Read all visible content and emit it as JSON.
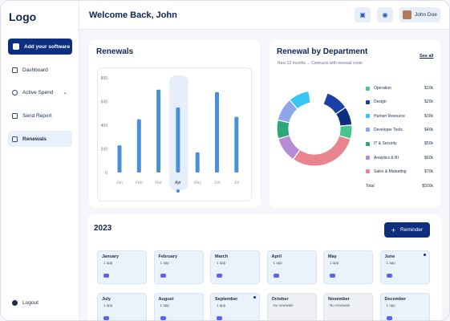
{
  "sidebar": {
    "logo": "Logo",
    "add_button": "Add your software",
    "items": [
      {
        "label": "Dashboard",
        "icon": "grid-icon"
      },
      {
        "label": "Active Spend",
        "icon": "refresh-icon"
      },
      {
        "label": "Send Report",
        "icon": "document-icon"
      },
      {
        "label": "Renewals",
        "icon": "calendar-icon"
      }
    ],
    "logout": "Logout"
  },
  "header": {
    "welcome": "Welcome Back, John",
    "user_name": "John Doe"
  },
  "renewals": {
    "title": "Renewals"
  },
  "chart_data": {
    "type": "bar",
    "categories": [
      "Jan",
      "Feb",
      "Mar",
      "Apr",
      "May",
      "Jun",
      "Jul"
    ],
    "series": [
      {
        "values": [
          230,
          450,
          700,
          550,
          170,
          680,
          470
        ]
      },
      {
        "values": [
          0,
          0,
          0,
          0,
          0,
          0,
          0
        ]
      }
    ],
    "highlight_category": "Apr",
    "yticks": [
      0,
      200,
      400,
      600,
      800
    ],
    "ylim": [
      0,
      800
    ],
    "title": "Renewals"
  },
  "department": {
    "title": "Renewal by Department",
    "subtitle": "Next 12 months ... Contracts with renewal costs",
    "see_all": "See all",
    "total_label": "Total",
    "total_value": "$500k",
    "items": [
      {
        "label": "Operation",
        "value": "$10k",
        "color": "#4cc38a"
      },
      {
        "label": "Design",
        "value": "$20k",
        "color": "#1a3fa6"
      },
      {
        "label": "Human Resource",
        "value": "$30k",
        "color": "#35c6f4"
      },
      {
        "label": "Developer Tools",
        "value": "$40k",
        "color": "#8fa6ea"
      },
      {
        "label": "IT & Security",
        "value": "$50k",
        "color": "#2ea67a"
      },
      {
        "label": "Analytics & BI",
        "value": "$60k",
        "color": "#b48bd6"
      },
      {
        "label": "Sales & Marketing",
        "value": "$70k",
        "color": "#e9848f"
      }
    ],
    "donut_order": [
      {
        "name": "Design",
        "share": 0.1,
        "color": "#1a3fa6"
      },
      {
        "name": "Navy",
        "share": 0.08,
        "color": "#0e2f80"
      },
      {
        "name": "Operation",
        "share": 0.06,
        "color": "#4cc38a"
      },
      {
        "name": "Sales & Marketing",
        "share": 0.3,
        "color": "#e9848f"
      },
      {
        "name": "Analytics & BI",
        "share": 0.11,
        "color": "#b48bd6"
      },
      {
        "name": "IT & Security",
        "share": 0.08,
        "color": "#2ea67a"
      },
      {
        "name": "Developer Tools",
        "share": 0.1,
        "color": "#8fa6ea"
      },
      {
        "name": "Human Resource",
        "share": 0.09,
        "color": "#35c6f4"
      }
    ]
  },
  "months_section": {
    "year": "2023",
    "reminder_button": "Reminder",
    "months": [
      {
        "name": "January",
        "count": "1 app",
        "grey": false,
        "dot": false
      },
      {
        "name": "February",
        "count": "1 app",
        "grey": false,
        "dot": false
      },
      {
        "name": "March",
        "count": "1 app",
        "grey": false,
        "dot": false
      },
      {
        "name": "April",
        "count": "1 app",
        "grey": false,
        "dot": false
      },
      {
        "name": "May",
        "count": "1 app",
        "grey": false,
        "dot": false
      },
      {
        "name": "June",
        "count": "1 app",
        "grey": false,
        "dot": true
      },
      {
        "name": "July",
        "count": "1 app",
        "grey": false,
        "dot": false
      },
      {
        "name": "August",
        "count": "1 app",
        "grey": false,
        "dot": false
      },
      {
        "name": "September",
        "count": "1 app",
        "grey": false,
        "dot": true
      },
      {
        "name": "October",
        "count": "No renewals",
        "grey": true,
        "dot": false
      },
      {
        "name": "November",
        "count": "No renewals",
        "grey": true,
        "dot": false
      },
      {
        "name": "December",
        "count": "1 app",
        "grey": false,
        "dot": false
      }
    ]
  }
}
